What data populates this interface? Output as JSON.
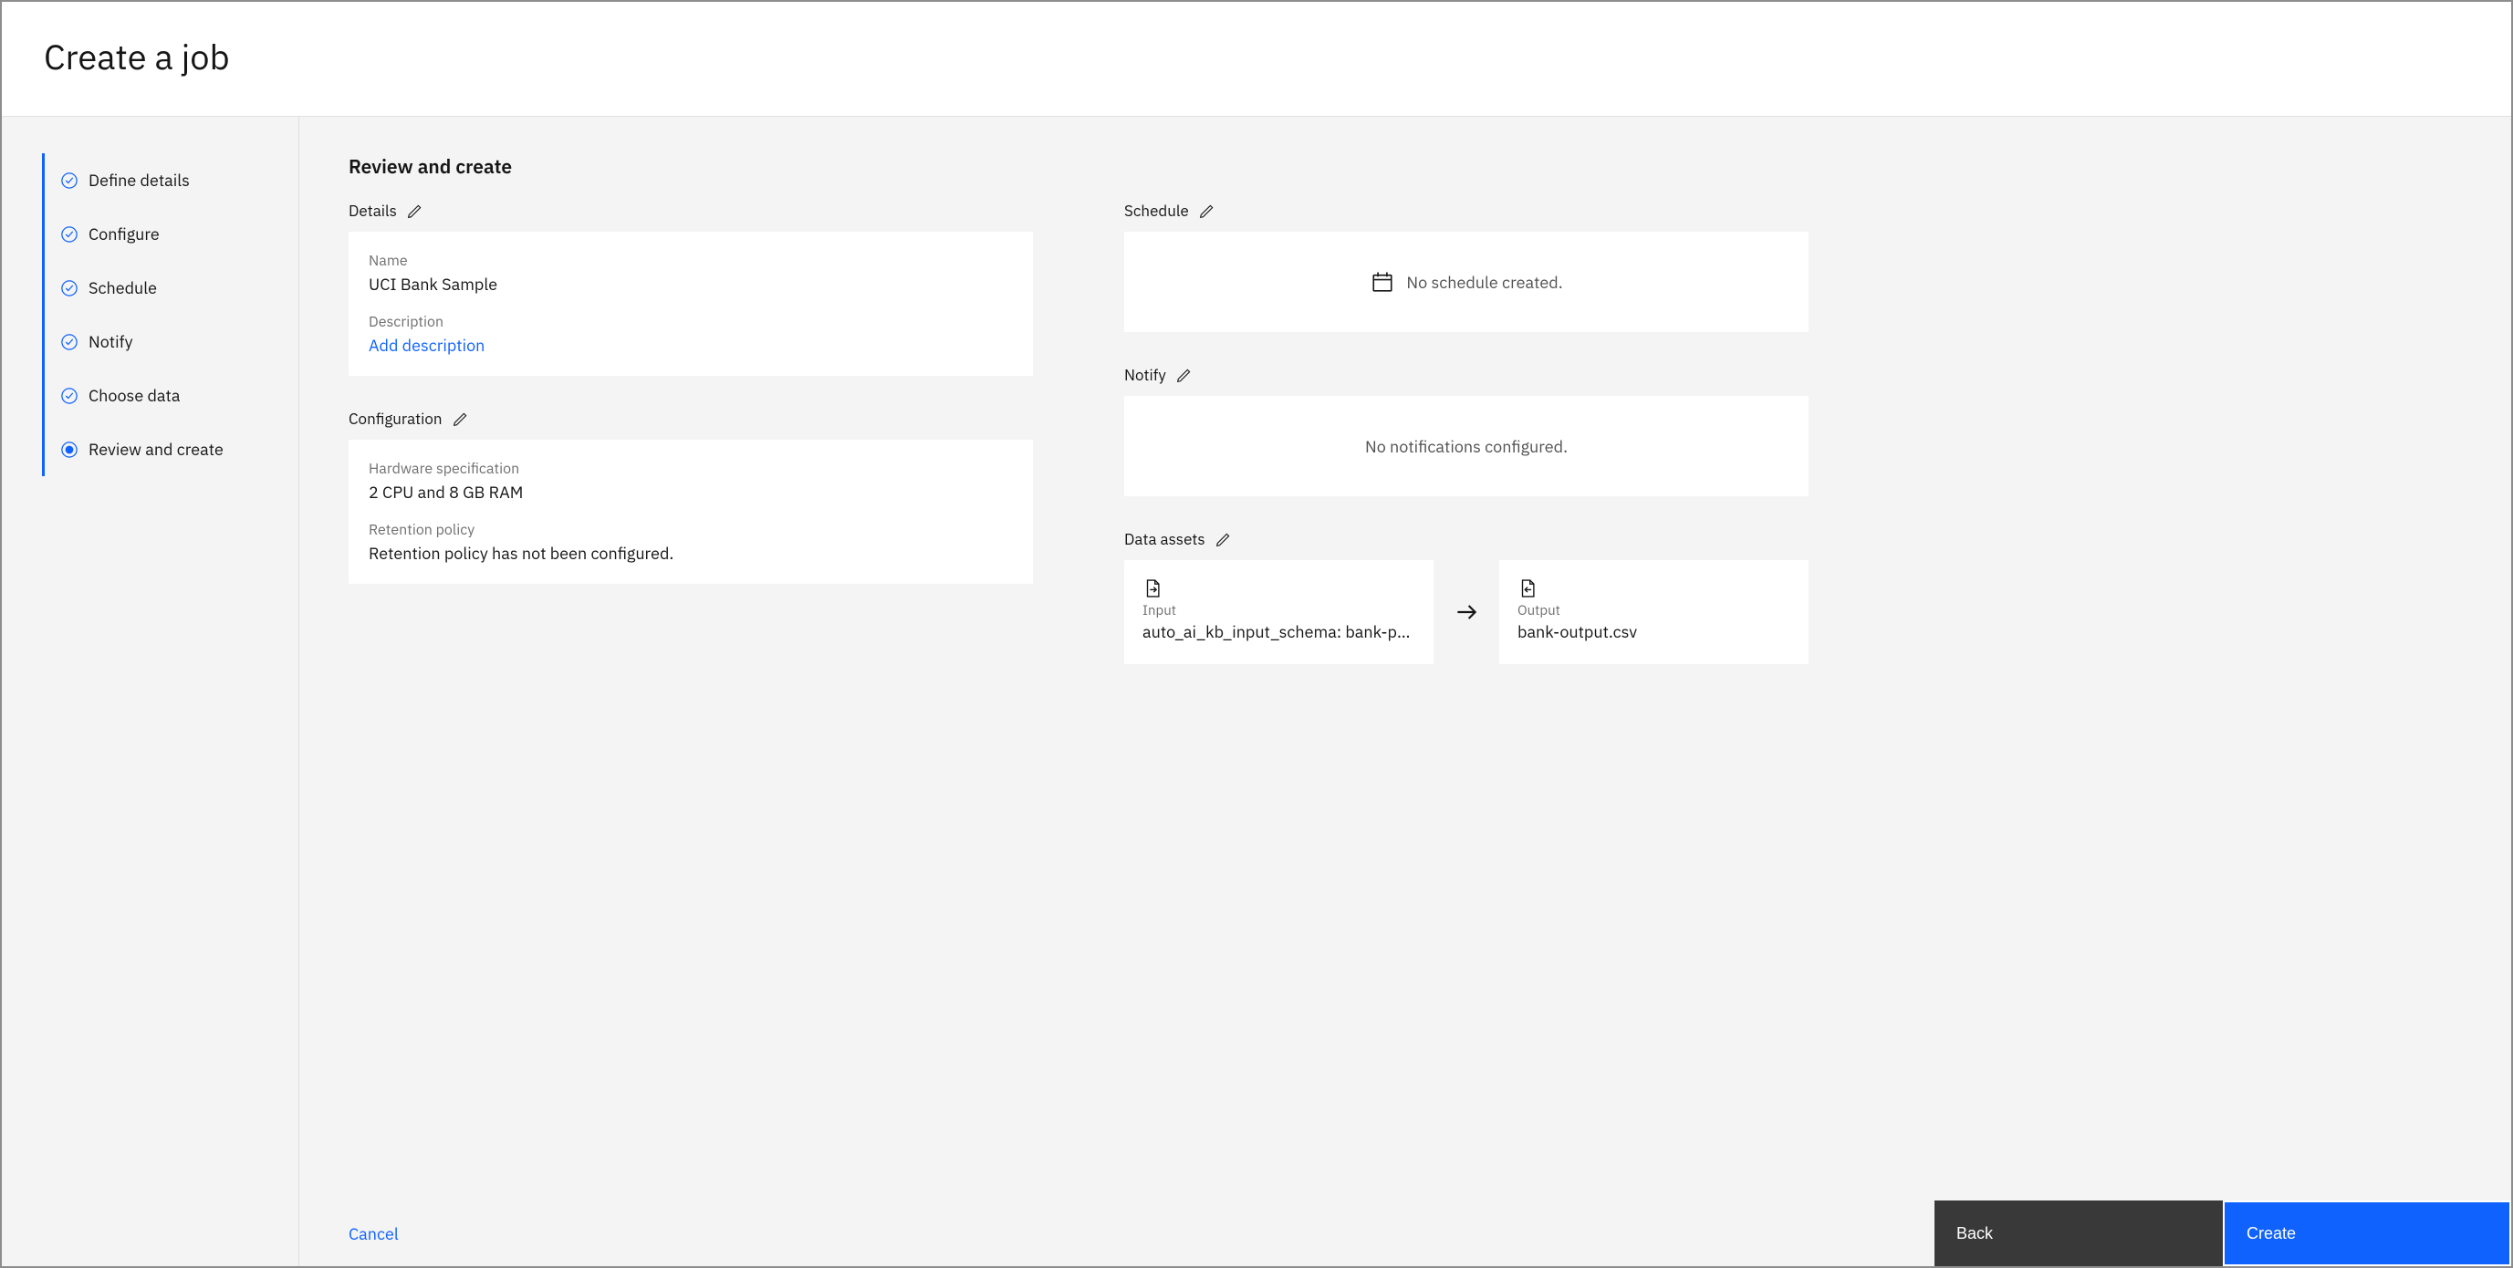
{
  "header": {
    "title": "Create a job"
  },
  "steps": [
    {
      "label": "Define details"
    },
    {
      "label": "Configure"
    },
    {
      "label": "Schedule"
    },
    {
      "label": "Notify"
    },
    {
      "label": "Choose data"
    },
    {
      "label": "Review and create"
    }
  ],
  "main": {
    "heading": "Review and create",
    "details": {
      "title": "Details",
      "name_label": "Name",
      "name_value": "UCI Bank Sample",
      "desc_label": "Description",
      "desc_link": "Add description"
    },
    "config": {
      "title": "Configuration",
      "hw_label": "Hardware specification",
      "hw_value": "2 CPU and 8 GB RAM",
      "ret_label": "Retention policy",
      "ret_value": "Retention policy has not been configured."
    },
    "schedule": {
      "title": "Schedule",
      "empty": "No schedule created."
    },
    "notify": {
      "title": "Notify",
      "empty": "No notifications configured."
    },
    "assets": {
      "title": "Data assets",
      "input_label": "Input",
      "input_value": "auto_ai_kb_input_schema: bank-pa...",
      "output_label": "Output",
      "output_value": "bank-output.csv"
    }
  },
  "footer": {
    "cancel": "Cancel",
    "back": "Back",
    "create": "Create"
  }
}
